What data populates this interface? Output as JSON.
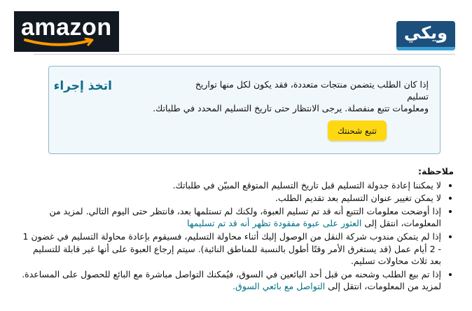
{
  "header": {
    "amazon_logo": "amazon",
    "wiki_logo": "ويكي"
  },
  "alert": {
    "heading": "اتخذ إجراء",
    "text_line1": "إذا كان الطلب يتضمن منتجات متعددة، فقد يكون لكل منها تواريخ تسليم",
    "text_rest": "ومعلومات تتبع منفصلة. يرجى الانتظار حتى تاريخ التسليم المحدد في طلباتك.",
    "button_label": "تتبع شحنتك"
  },
  "notes": {
    "title": "ملاحظة:",
    "item1": "لا يمكننا إعادة جدولة التسليم قبل تاريخ التسليم المتوقع المبيّن في طلباتك.",
    "item2": "لا يمكن تغيير عنوان التسليم بعد تقديم الطلب.",
    "item3_text": "إذا أوضحت معلومات التتبع أنه قد تم تسليم العبوة، ولكنك لم تستلمها بعد، فانتظر حتى اليوم التالي. لمزيد من المعلومات، انتقل إلى",
    "item3_link": "العثور على عبوة مفقودة تظهر أنه قد تم تسليمها",
    "item4": "إذا لم يتمكن مندوب شركة النقل من الوصول إليك أثناء محاولة التسليم، فسيقوم بإعادة محاولة التسليم في غضون 1 - 2 أيام عمل (قد يستغرق الأمر وقتًا أطول بالنسبة للمناطق النائية). سيتم إرجاع العبوة على أنها غير قابلة للتسليم بعد ثلاث محاولات تسليم.",
    "item5_text": "إذا تم بيع الطلب وشحنه من قبل أحد البائعين في السوق، فيُمكنك التواصل مباشرة مع البائع للحصول على المساعدة. لمزيد من المعلومات، انتقل إلى",
    "item5_link": "التواصل مع بائعي السوق."
  },
  "colors": {
    "alert_heading": "#0e6b8a",
    "alert_border": "#8fb7c6",
    "alert_background": "#f1f8fb",
    "button": "#ffd814",
    "link": "#007185",
    "amazon_bg": "#131921",
    "amazon_smile": "#ff9900",
    "wiki_bg": "#1d4f7c"
  }
}
